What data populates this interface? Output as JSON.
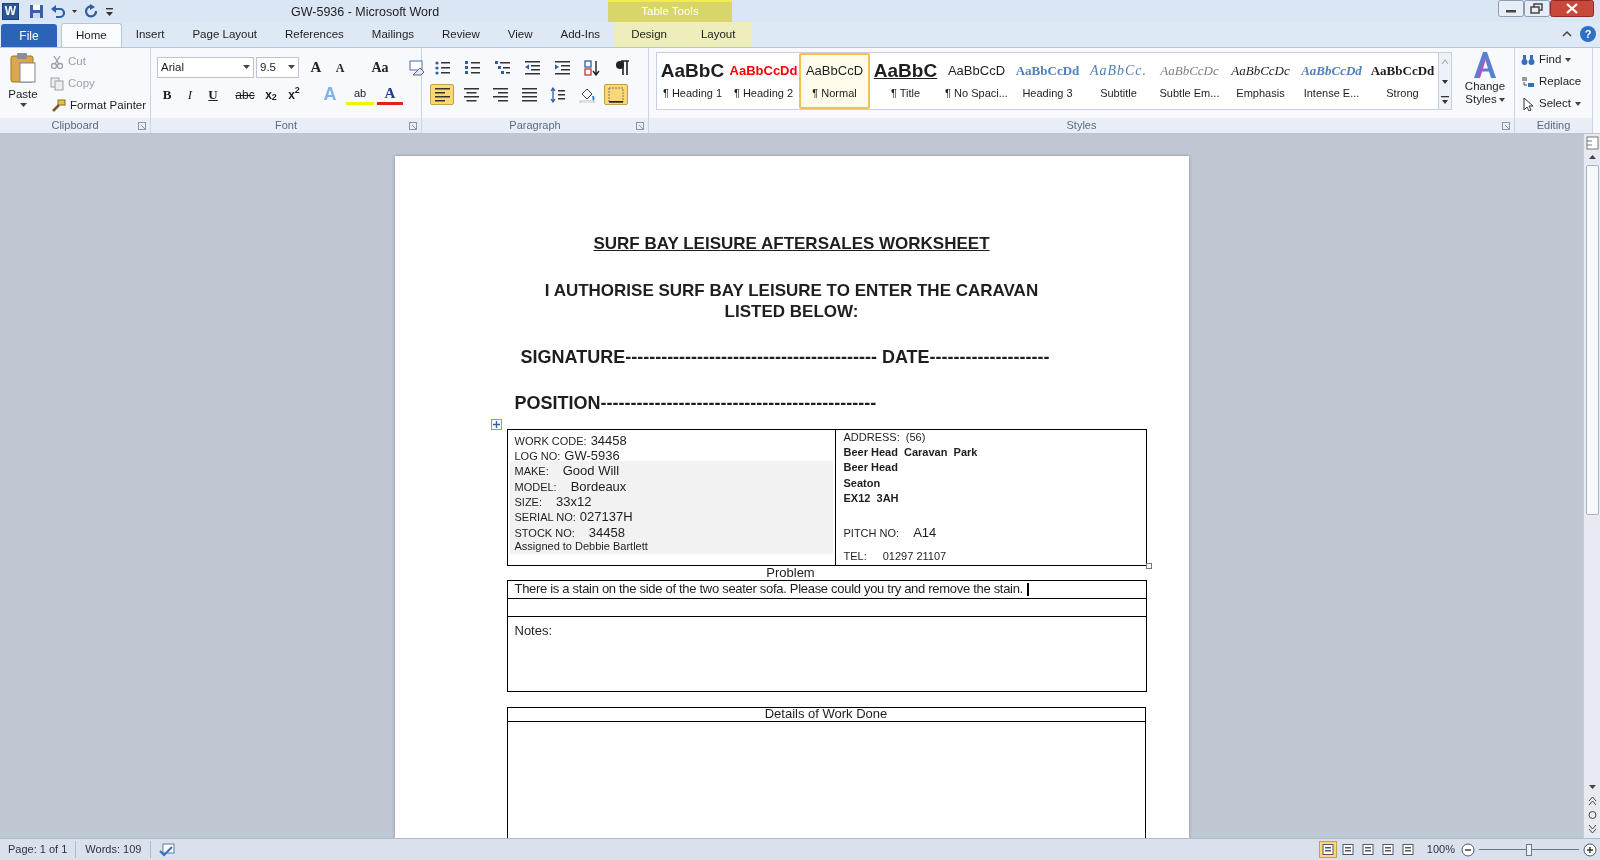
{
  "window": {
    "app_icon": "W",
    "title": "GW-5936  -  Microsoft Word"
  },
  "quick_access": [
    {
      "kind": "save"
    },
    {
      "kind": "undo"
    },
    {
      "kind": "caret"
    },
    {
      "kind": "redo"
    },
    {
      "kind": "customize"
    }
  ],
  "contextual_group": "Table Tools",
  "tabs": [
    {
      "label": "File",
      "kind": "file",
      "selected": false
    },
    {
      "label": "Home",
      "kind": "tab",
      "selected": true
    },
    {
      "label": "Insert",
      "kind": "tab",
      "selected": false
    },
    {
      "label": "Page Layout",
      "kind": "tab",
      "selected": false
    },
    {
      "label": "References",
      "kind": "tab",
      "selected": false
    },
    {
      "label": "Mailings",
      "kind": "tab",
      "selected": false
    },
    {
      "label": "Review",
      "kind": "tab",
      "selected": false
    },
    {
      "label": "View",
      "kind": "tab",
      "selected": false
    },
    {
      "label": "Add-Ins",
      "kind": "tab",
      "selected": false
    },
    {
      "label": "Design",
      "kind": "context",
      "selected": false
    },
    {
      "label": "Layout",
      "kind": "context",
      "selected": false
    }
  ],
  "help": "?",
  "clipboard": {
    "label": "Clipboard",
    "paste": "Paste",
    "items": [
      {
        "label": "Cut",
        "kind": "cut",
        "disabled": true
      },
      {
        "label": "Copy",
        "kind": "copy",
        "disabled": true
      },
      {
        "label": "Format Painter",
        "kind": "painter",
        "disabled": false
      }
    ]
  },
  "font": {
    "label": "Font",
    "name": "Arial",
    "size": "9.5",
    "row1": [
      {
        "text": "A",
        "kind": "grow"
      },
      {
        "text": "A",
        "kind": "shrink"
      },
      {
        "text": "Aa",
        "kind": "case"
      },
      {
        "kind": "clear"
      }
    ],
    "row2": [
      {
        "text": "B",
        "kind": "bold"
      },
      {
        "text": "I",
        "kind": "italic"
      },
      {
        "text": "U",
        "kind": "underline"
      },
      {
        "text": "abc",
        "kind": "strike"
      },
      {
        "text": "x$_{2}$",
        "kind": "sub"
      },
      {
        "text": "x$^{2}$",
        "kind": "sup"
      },
      {
        "text": "A",
        "kind": "effect"
      },
      {
        "text": "ab",
        "kind": "highlight"
      },
      {
        "text": "A",
        "kind": "color"
      }
    ]
  },
  "paragraph": {
    "label": "Paragraph",
    "row1": [
      {
        "kind": "bullets",
        "selected": false
      },
      {
        "kind": "numbering",
        "selected": false
      },
      {
        "kind": "multilevel",
        "selected": false
      },
      {
        "kind": "outdent",
        "selected": false
      },
      {
        "kind": "indent",
        "selected": false
      },
      {
        "kind": "sort",
        "selected": false
      },
      {
        "kind": "pilcrow",
        "selected": false
      }
    ],
    "row2": [
      {
        "kind": "align-left",
        "selected": true
      },
      {
        "kind": "align-center",
        "selected": false
      },
      {
        "kind": "align-right",
        "selected": false
      },
      {
        "kind": "justify",
        "selected": false
      },
      {
        "kind": "line-spacing",
        "selected": false
      },
      {
        "kind": "shading",
        "selected": false
      },
      {
        "kind": "borders",
        "selected": true
      }
    ]
  },
  "styles": {
    "label": "Styles",
    "items": [
      {
        "sample": "AaBbC",
        "label": "¶ Heading 1",
        "kind": "heading1",
        "selected": false
      },
      {
        "sample": "AaBbCcDd",
        "label": "¶ Heading 2",
        "kind": "heading2",
        "selected": false
      },
      {
        "sample": "AaBbCcD",
        "label": "¶ Normal",
        "kind": "normal",
        "selected": true
      },
      {
        "sample": "AaBbC",
        "label": "¶ Title",
        "kind": "title",
        "selected": false
      },
      {
        "sample": "AaBbCcD",
        "label": "¶ No Spaci...",
        "kind": "normal",
        "selected": false
      },
      {
        "sample": "AaBbCcDd",
        "label": "Heading 3",
        "kind": "heading3",
        "selected": false
      },
      {
        "sample": "AaBbCc.",
        "label": "Subtitle",
        "kind": "subtitle",
        "selected": false
      },
      {
        "sample": "AaBbCcDc",
        "label": "Subtle Em...",
        "kind": "subtle",
        "selected": false
      },
      {
        "sample": "AaBbCcDc",
        "label": "Emphasis",
        "kind": "emphasis",
        "selected": false
      },
      {
        "sample": "AaBbCcDd",
        "label": "Intense E...",
        "kind": "intense",
        "selected": false
      },
      {
        "sample": "AaBbCcDd",
        "label": "Strong",
        "kind": "strong",
        "selected": false
      }
    ],
    "change_styles": [
      "Change",
      "Styles"
    ]
  },
  "editing": {
    "label": "Editing",
    "items": [
      {
        "label": "Find",
        "kind": "find"
      },
      {
        "label": "Replace",
        "kind": "replace"
      },
      {
        "label": "Select",
        "kind": "select"
      }
    ]
  },
  "document": {
    "title": "SURF BAY LEISURE AFTERSALES WORKSHEET",
    "authorise": [
      "I AUTHORISE SURF BAY LEISURE TO ENTER THE CARAVAN",
      "LISTED BELOW:"
    ],
    "signature_line": "SIGNATURE------------------------------------------ DATE--------------------",
    "position_line": "POSITION----------------------------------------------",
    "details_left": [
      {
        "label": "WORK CODE:",
        "value": "34458",
        "shaded": false
      },
      {
        "label": "LOG NO:",
        "value": "GW-5936",
        "shaded": false
      },
      {
        "label": "MAKE:",
        "value": "Good Will",
        "shaded": true
      },
      {
        "label": "MODEL:",
        "value": "Bordeaux",
        "shaded": true
      },
      {
        "label": "SIZE:",
        "value": "33x12",
        "shaded": true
      },
      {
        "label": "SERIAL  NO:",
        "value": "027137H",
        "shaded": true
      },
      {
        "label": "STOCK NO:",
        "value": "34458",
        "shaded": true
      }
    ],
    "assigned": "Assigned to Debbie Bartlett",
    "address_label": "ADDRESS:",
    "address_number": "(56)",
    "address_lines": [
      "Beer Head  Caravan  Park",
      "Beer Head",
      "Seaton",
      "EX12  3AH"
    ],
    "pitch_label": "PITCH NO:",
    "pitch": "A14",
    "tel_label": "TEL:",
    "tel": "01297 21107",
    "problem_heading": "Problem",
    "problem_text": "There is a stain on the side of the two seater sofa. Please could you try and remove the stain.",
    "notes_label": "Notes:",
    "work_heading": "Details of Work Done"
  },
  "status_bar": {
    "page": "Page: 1 of 1",
    "words": "Words: 109",
    "views": [
      {
        "selected": true
      },
      {
        "selected": false
      },
      {
        "selected": false
      },
      {
        "selected": false
      },
      {
        "selected": false
      }
    ],
    "zoom": "100%",
    "zoom_slider": {
      "level": 0.5
    }
  }
}
